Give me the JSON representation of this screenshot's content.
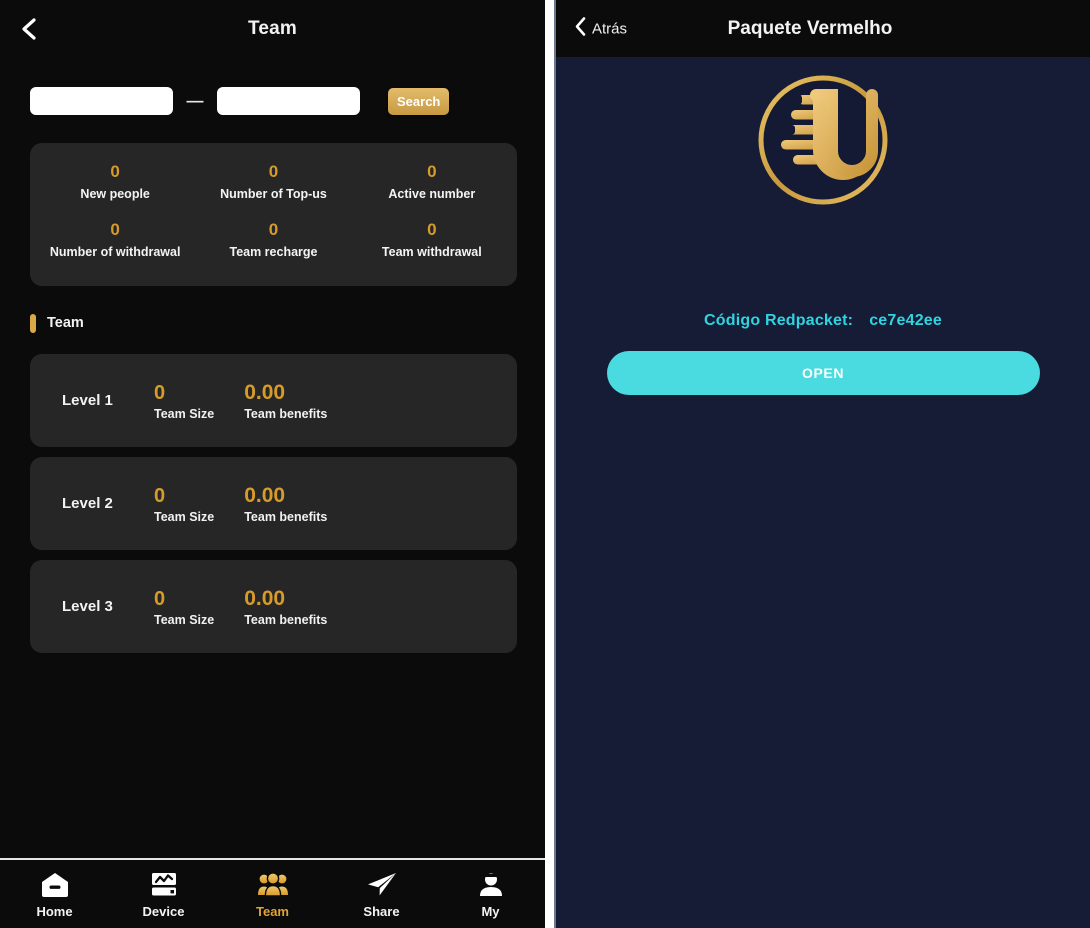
{
  "left": {
    "header": {
      "back_icon": "chevron-left-icon",
      "title": "Team"
    },
    "search": {
      "from_value": "",
      "from_placeholder": "",
      "separator": "—",
      "to_value": "",
      "to_placeholder": "",
      "button_label": "Search"
    },
    "stats": [
      {
        "value": "0",
        "label": "New people"
      },
      {
        "value": "0",
        "label": "Number of Top-us"
      },
      {
        "value": "0",
        "label": "Active number"
      },
      {
        "value": "0",
        "label": "Number of withdrawal"
      },
      {
        "value": "0",
        "label": "Team recharge"
      },
      {
        "value": "0",
        "label": "Team withdrawal"
      }
    ],
    "section": {
      "label": "Team"
    },
    "levels": [
      {
        "name": "Level 1",
        "size_value": "0",
        "size_label": "Team Size",
        "benefits_value": "0.00",
        "benefits_label": "Team benefits"
      },
      {
        "name": "Level 2",
        "size_value": "0",
        "size_label": "Team Size",
        "benefits_value": "0.00",
        "benefits_label": "Team benefits"
      },
      {
        "name": "Level 3",
        "size_value": "0",
        "size_label": "Team Size",
        "benefits_value": "0.00",
        "benefits_label": "Team benefits"
      }
    ],
    "tabbar": [
      {
        "label": "Home",
        "icon": "home-icon",
        "active": false
      },
      {
        "label": "Device",
        "icon": "device-icon",
        "active": false
      },
      {
        "label": "Team",
        "icon": "team-icon",
        "active": true
      },
      {
        "label": "Share",
        "icon": "share-icon",
        "active": false
      },
      {
        "label": "My",
        "icon": "person-icon",
        "active": false
      }
    ]
  },
  "right": {
    "header": {
      "back_icon": "chevron-left-icon",
      "back_label": "Atrás",
      "title": "Paquete Vermelho"
    },
    "logo": {
      "icon": "u-coin-logo-icon"
    },
    "code_label": "Código Redpacket:",
    "code_value": "ce7e42ee",
    "open_button_label": "OPEN"
  },
  "colors": {
    "gold": "#d79b2a",
    "gold_bar": "#d9a944",
    "cyan": "#2fd4e0",
    "open_button": "#49dbdf",
    "panel_dark": "#0b0b0b",
    "card": "#262626",
    "navy": "#161c35"
  }
}
